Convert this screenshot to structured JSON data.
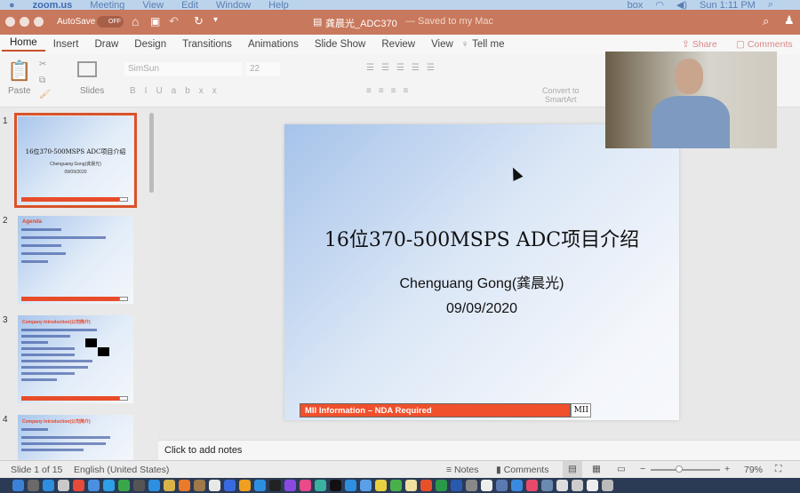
{
  "menubar": {
    "app": "zoom.us",
    "items": [
      "Meeting",
      "View",
      "Edit",
      "Window",
      "Help"
    ],
    "clock": "Sun 1:11 PM",
    "box": "box"
  },
  "titlebar": {
    "autosave": "AutoSave",
    "autosave_state": "OFF",
    "doc_name": "龚晨光_ADC370",
    "saved": "— Saved to my Mac"
  },
  "tabs": [
    "Home",
    "Insert",
    "Draw",
    "Design",
    "Transitions",
    "Animations",
    "Slide Show",
    "Review",
    "View"
  ],
  "tell_me": "Tell me",
  "share": "Share",
  "comments": "Comments",
  "ribbon": {
    "paste": "Paste",
    "slides": "Slides",
    "font": "SimSun",
    "font_size": "22",
    "convert1": "Convert to",
    "convert2": "SmartArt"
  },
  "thumbnails": [
    {
      "num": "1",
      "title": "16位370-500MSPS ADC项目介绍",
      "sub": "Chenguang Gong(龚晨光)",
      "date": "09/09/2020"
    },
    {
      "num": "2",
      "title": "Agenda"
    },
    {
      "num": "3",
      "title": "Company Introduction(公司简介)"
    },
    {
      "num": "4",
      "title": "Company Introduction(公司简介)"
    }
  ],
  "slide": {
    "title": "16位370-500MSPS ADC项目介绍",
    "presenter": "Chenguang Gong(龚晨光)",
    "date": "09/09/2020",
    "footer": "MII Information – NDA Required",
    "logo": "MII"
  },
  "notes_placeholder": "Click to add notes",
  "status": {
    "slide": "Slide 1 of 15",
    "language": "English (United States)",
    "notes": "Notes",
    "comments": "Comments",
    "zoom": "79%",
    "zoom_level": 0.79
  },
  "colors": {
    "titlebar": "#c8785c",
    "accent": "#d9532a",
    "footer": "#f0502c"
  }
}
